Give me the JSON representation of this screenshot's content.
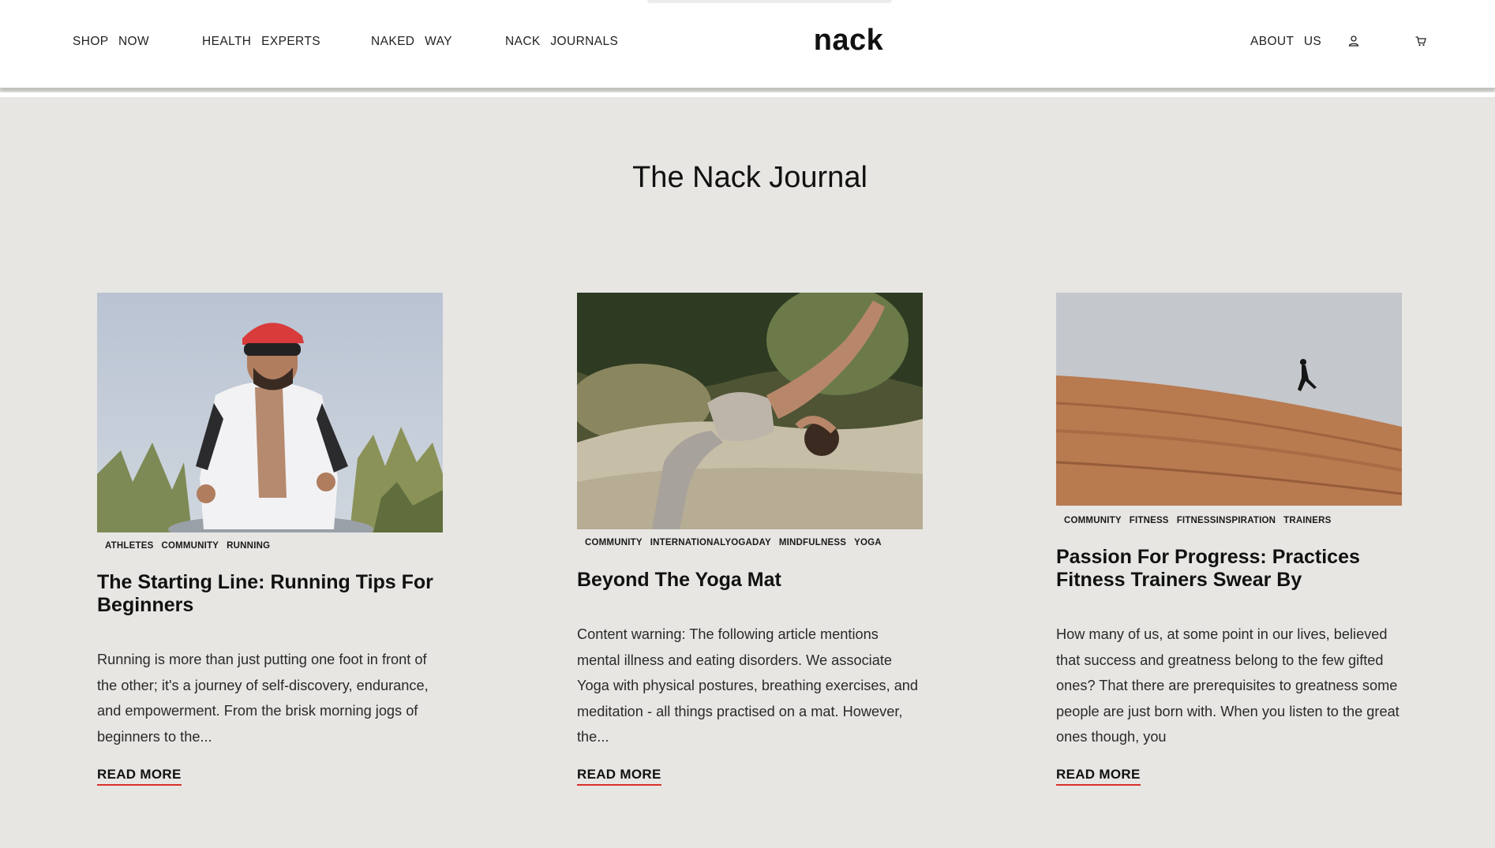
{
  "header": {
    "nav_left": [
      {
        "label": "SHOP NOW"
      },
      {
        "label": "HEALTH EXPERTS"
      },
      {
        "label": "NAKED WAY"
      },
      {
        "label": "NACK JOURNALS"
      }
    ],
    "logo": "nack",
    "about_label": "ABOUT US",
    "icons": {
      "account": "user-icon",
      "cart": "cart-icon"
    }
  },
  "page": {
    "title": "The Nack Journal"
  },
  "articles": [
    {
      "tags": [
        "ATHLETES",
        "COMMUNITY",
        "RUNNING"
      ],
      "title": "The Starting Line: Running Tips For Beginners",
      "excerpt": "Running is more than just putting one foot in front of the other; it's a journey of self-discovery, endurance, and empowerment. From the brisk morning jogs of beginners to the...",
      "read_more": "READ MORE"
    },
    {
      "tags": [
        "COMMUNITY",
        "INTERNATIONALYOGADAY",
        "MINDFULNESS",
        "YOGA"
      ],
      "title": "Beyond The Yoga Mat",
      "excerpt": "Content warning: The following article mentions mental illness and eating disorders. We associate Yoga with physical postures, breathing exercises, and meditation - all things practised on a mat. However, the...",
      "read_more": "READ MORE"
    },
    {
      "tags": [
        "COMMUNITY",
        "FITNESS",
        "FITNESSINSPIRATION",
        "TRAINERS"
      ],
      "title": "Passion For Progress: Practices Fitness Trainers Swear By",
      "excerpt": "How many of us, at some point in our lives, believed that success and greatness belong to the few gifted ones? That there are prerequisites to greatness some people are just born with. When you listen to the great ones though, you",
      "read_more": "READ MORE"
    }
  ],
  "colors": {
    "background": "#e7e6e3",
    "header_bg": "#ffffff",
    "accent_underline": "#d9302a",
    "text": "#111111"
  }
}
